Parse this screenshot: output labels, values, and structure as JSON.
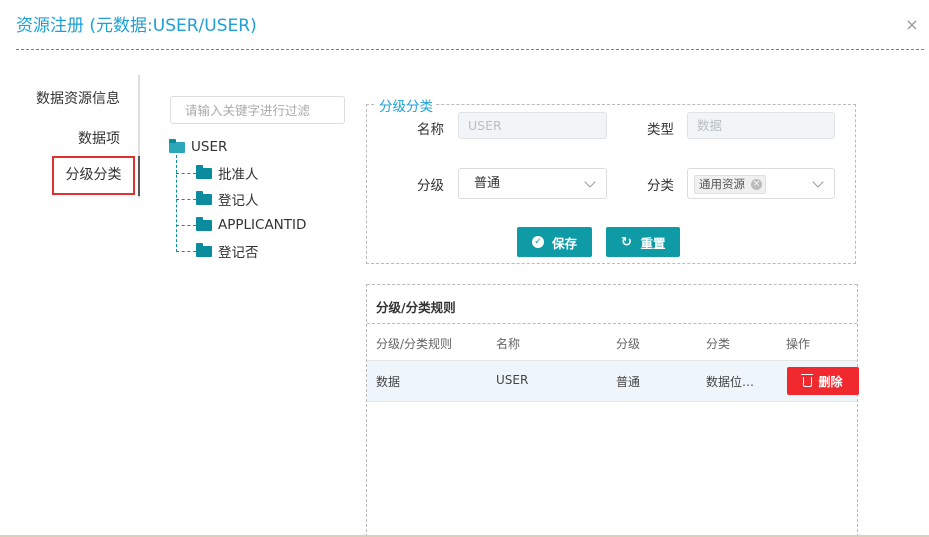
{
  "dialog": {
    "title": "资源注册 (元数据:USER/USER)",
    "close_icon": "×"
  },
  "nav": {
    "items": [
      {
        "label": "数据资源信息",
        "active": false
      },
      {
        "label": "数据项",
        "active": false
      },
      {
        "label": "分级分类",
        "active": true
      }
    ]
  },
  "tree": {
    "search_placeholder": "请输入关键字进行过滤",
    "root": "USER",
    "children": [
      "批准人",
      "登记人",
      "APPLICANTID",
      "登记否"
    ]
  },
  "form": {
    "legend": "分级分类",
    "name_label": "名称",
    "name_value": "USER",
    "type_label": "类型",
    "type_value": "数据",
    "level_label": "分级",
    "level_value": "普通",
    "category_label": "分类",
    "category_tag": "通用资源",
    "save_label": "保存",
    "reset_label": "重置"
  },
  "rules": {
    "title": "分级/分类规则",
    "columns": [
      "分级/分类规则",
      "名称",
      "分级",
      "分类",
      "操作"
    ],
    "rows": [
      {
        "rule": "数据",
        "name": "USER",
        "level": "普通",
        "category": "数据位…",
        "action": "删除"
      }
    ]
  },
  "colors": {
    "accent": "#1e9fd6",
    "primary_button": "#0f9ba6",
    "danger_button": "#f0292e",
    "active_outline": "#e0312c",
    "tree_folder": "#0b8b9e"
  }
}
